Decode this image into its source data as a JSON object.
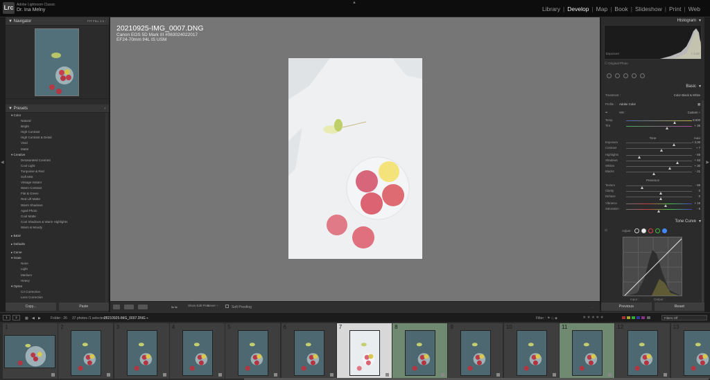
{
  "topbar": {
    "app_name": "Adobe Lightroom Classic",
    "user_name": "Dr. Ina Melny",
    "logo": "Lrc",
    "modules": [
      "Library",
      "Develop",
      "Map",
      "Book",
      "Slideshow",
      "Print",
      "Web"
    ],
    "active_module": "Develop"
  },
  "navigator": {
    "title": "Navigator",
    "zoom_options": "FIT  FILL  1:1  ·"
  },
  "presets": {
    "title": "Presets",
    "groups": [
      {
        "label": "Color",
        "items": [
          "Natural",
          "Bright",
          "High Contrast",
          "High Contrast & Detail",
          "Vivid",
          "Matte"
        ]
      },
      {
        "label": "Creative",
        "items": [
          "Desaturated Contrast",
          "Cool Light",
          "Turquoise & Red",
          "Soft Mist",
          "Vintage Instant",
          "Warm Contrast",
          "Flat & Green",
          "Red Lift Matte",
          "Warm Shadows",
          "Aged Photo",
          "Cool Matte",
          "Cool Shadows & Warm Highlights",
          "Warm & Moody"
        ]
      },
      {
        "label": "B&W",
        "items": []
      },
      {
        "label": "Defaults",
        "items": []
      },
      {
        "label": "Curve",
        "items": []
      },
      {
        "label": "Grain",
        "items": [
          "None",
          "Light",
          "Medium",
          "Heavy"
        ]
      },
      {
        "label": "Optics",
        "items": [
          "CA Correction",
          "Lens Correction"
        ]
      }
    ]
  },
  "left_buttons": {
    "copy": "Copy...",
    "paste": "Paste"
  },
  "info_overlay": {
    "filename": "20210925-IMG_0007.DNG",
    "camera": "Canon EOS 5D Mark III #063024022017",
    "lens": "EF24-70mm f/4L IS USM"
  },
  "toolbar": {
    "show_edit_pins": "Show Edit Pins :",
    "pins_value": "Never ÷",
    "soft_proofing": "Soft Proofing"
  },
  "histogram": {
    "title": "Histogram",
    "exposure_label": "Exposure",
    "exposure_value": "+ 2,00",
    "original_photo": "Original Photo"
  },
  "basic": {
    "title": "Basic",
    "treatment_label": "Treatment :",
    "treatment_color": "Color",
    "treatment_bw": "Black & White",
    "profile_label": "Profile :",
    "profile_value": "Adobe Color",
    "wb_label": "WB :",
    "wb_value": "Custom ÷",
    "tone_label": "Tone",
    "auto_label": "Auto",
    "presence_label": "Presence",
    "sliders": [
      {
        "label": "Temp",
        "value": "8.600",
        "pos": 0.72
      },
      {
        "label": "Tint",
        "value": "+ 35",
        "pos": 0.6
      },
      {
        "label": "Exposure",
        "value": "+ 2,00",
        "pos": 0.7
      },
      {
        "label": "Contrast",
        "value": "+ 7",
        "pos": 0.52
      },
      {
        "label": "Highlights",
        "value": "- 65",
        "pos": 0.18
      },
      {
        "label": "Shadows",
        "value": "+ 53",
        "pos": 0.76
      },
      {
        "label": "Whites",
        "value": "+ 30",
        "pos": 0.64
      },
      {
        "label": "Blacks",
        "value": "- 21",
        "pos": 0.4
      },
      {
        "label": "Texture",
        "value": "- 56",
        "pos": 0.22
      },
      {
        "label": "Clarity",
        "value": "0",
        "pos": 0.5
      },
      {
        "label": "Dehaze",
        "value": "0",
        "pos": 0.5
      },
      {
        "label": "Vibrance",
        "value": "+ 15",
        "pos": 0.58
      },
      {
        "label": "Saturation",
        "value": "- 5",
        "pos": 0.47
      }
    ]
  },
  "tone_curve": {
    "title": "Tone Curve",
    "adjust_label": "Adjust :",
    "input_label": "Input :",
    "output_label": "Output :"
  },
  "right_buttons": {
    "previous": "Previous",
    "reset": "Reset"
  },
  "filmstrip_bar": {
    "page1": "1",
    "page2": "2",
    "folder": "Folder : 26",
    "count": "37 photos /1 selected /",
    "selected_file": "20210925-IMG_0007.DNG ÷",
    "filter_label": "Filter :",
    "filters_off": "Filters Off",
    "stars": "★★★★★"
  },
  "filmstrip": {
    "cells": [
      "1",
      "2",
      "3",
      "4",
      "5",
      "6",
      "7",
      "8",
      "9",
      "10",
      "11",
      "12",
      "13"
    ],
    "selected_index": 7
  },
  "colors": {
    "bg": "#1c1c1c",
    "panel": "#2b2b2b",
    "workspace": "#767676",
    "active_text": "#eeeeee",
    "thumb_teal": "#4d6870",
    "apple_red": "#d45a62"
  }
}
